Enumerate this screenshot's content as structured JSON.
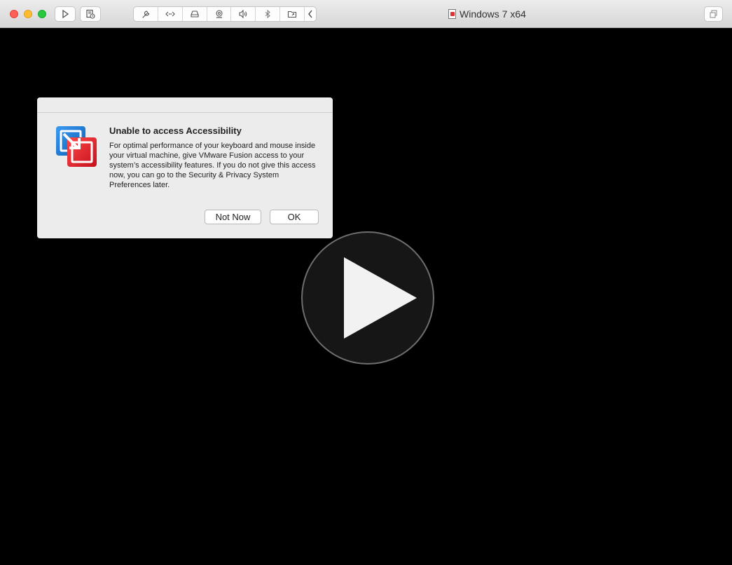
{
  "window": {
    "title": "Windows 7 x64"
  },
  "toolbar": {
    "buttons": [
      {
        "icon": "play-icon"
      },
      {
        "icon": "snapshot-icon"
      }
    ],
    "group": [
      {
        "icon": "wrench-icon"
      },
      {
        "icon": "network-icon"
      },
      {
        "icon": "disk-drive-icon"
      },
      {
        "icon": "camera-icon"
      },
      {
        "icon": "sound-icon"
      },
      {
        "icon": "bluetooth-icon"
      },
      {
        "icon": "shared-folder-icon"
      },
      {
        "icon": "chevron-left-icon"
      }
    ],
    "right_button": {
      "icon": "restore-icon"
    }
  },
  "dialog": {
    "title": "Unable to access Accessibility",
    "message": "For optimal performance of your keyboard and mouse inside your virtual machine, give VMware Fusion access to your system’s accessibility features. If you do not give this access now, you can go to the Security & Privacy System Preferences later.",
    "not_now_label": "Not Now",
    "ok_label": "OK"
  },
  "colors": {
    "close": "#fe5f57",
    "minimize": "#febc2e",
    "maximize": "#28c840",
    "vm_background": "#000000",
    "fusion_blue": "#1c7ad6",
    "fusion_red": "#e0202a"
  }
}
